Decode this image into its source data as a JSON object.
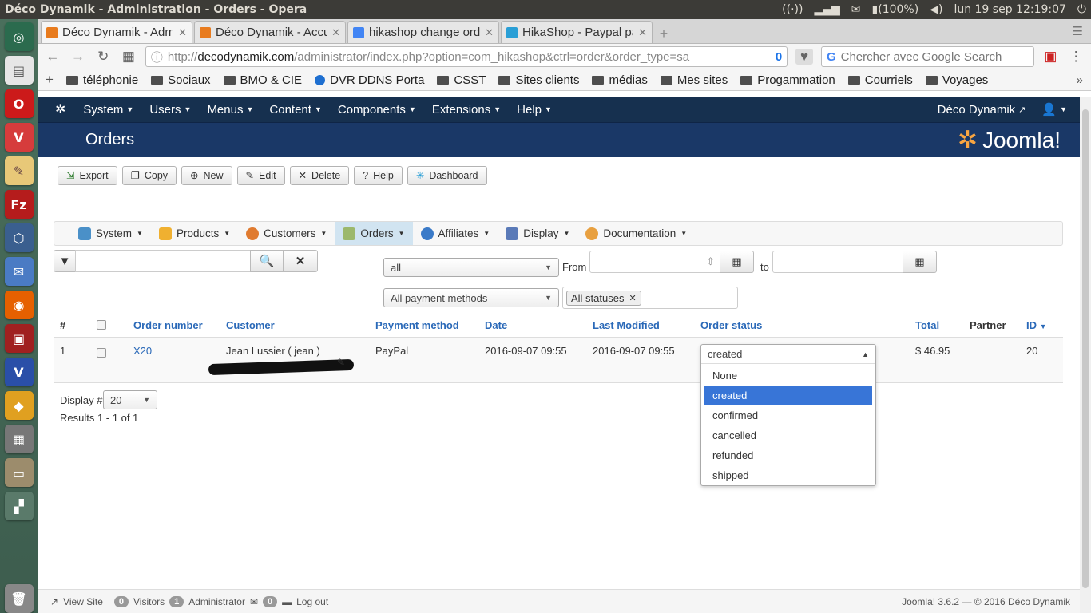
{
  "os": {
    "window_title": "Déco Dynamik - Administration - Orders - Opera",
    "battery": "(100%)",
    "clock": "lun 19 sep 12:19:07"
  },
  "tabs": [
    {
      "label": "Déco Dynamik - Adm",
      "active": true
    },
    {
      "label": "Déco Dynamik - Accu",
      "active": false
    },
    {
      "label": "hikashop change ord",
      "active": false
    },
    {
      "label": "HikaShop - Paypal pa",
      "active": false
    }
  ],
  "address": {
    "prefix": "http://",
    "host": "decodynamik.com",
    "path": "/administrator/index.php?option=com_hikashop&ctrl=order&order_type=sa",
    "badge": "0"
  },
  "search": {
    "placeholder": "Chercher avec Google Search"
  },
  "bookmarks": [
    "téléphonie",
    "Sociaux",
    "BMO & CIE",
    "DVR DDNS Porta",
    "CSST",
    "Sites clients",
    "médias",
    "Mes sites",
    "Progammation",
    "Courriels",
    "Voyages"
  ],
  "joomla_nav": {
    "menus": [
      "System",
      "Users",
      "Menus",
      "Content",
      "Components",
      "Extensions",
      "Help"
    ],
    "site_link": "Déco Dynamik"
  },
  "page_title": "Orders",
  "brand": "Joomla!",
  "toolbar": [
    "Export",
    "Copy",
    "New",
    "Edit",
    "Delete",
    "Help",
    "Dashboard"
  ],
  "hikamenu": [
    "System",
    "Products",
    "Customers",
    "Orders",
    "Affiliates",
    "Display",
    "Documentation"
  ],
  "filters": {
    "search_value": "",
    "order_type": "all",
    "from_label": "From",
    "to_label": "to",
    "payment": "All payment methods",
    "status_tag": "All statuses"
  },
  "table": {
    "headers": [
      "#",
      "Order number",
      "Customer",
      "Payment method",
      "Date",
      "Last Modified",
      "Order status",
      "Total",
      "Partner",
      "ID"
    ],
    "rows": [
      {
        "num": "1",
        "order": "X20",
        "customer": "Jean Lussier ( jean )",
        "payment": "PayPal",
        "date": "2016-09-07 09:55",
        "modified": "2016-09-07 09:55",
        "status": "created",
        "total": "$ 46.95",
        "partner": "",
        "id": "20"
      }
    ]
  },
  "status_dropdown": {
    "current": "created",
    "options": [
      "None",
      "created",
      "confirmed",
      "cancelled",
      "refunded",
      "shipped"
    ]
  },
  "pagination": {
    "display_label": "Display #",
    "display_value": "20",
    "results": "Results 1 - 1 of 1"
  },
  "footer": {
    "view_site": "View Site",
    "visitors_count": "0",
    "visitors_label": "Visitors",
    "admin_count": "1",
    "admin_label": "Administrator",
    "messages_count": "0",
    "logout": "Log out",
    "version": "Joomla! 3.6.2  —  © 2016 Déco Dynamik"
  }
}
